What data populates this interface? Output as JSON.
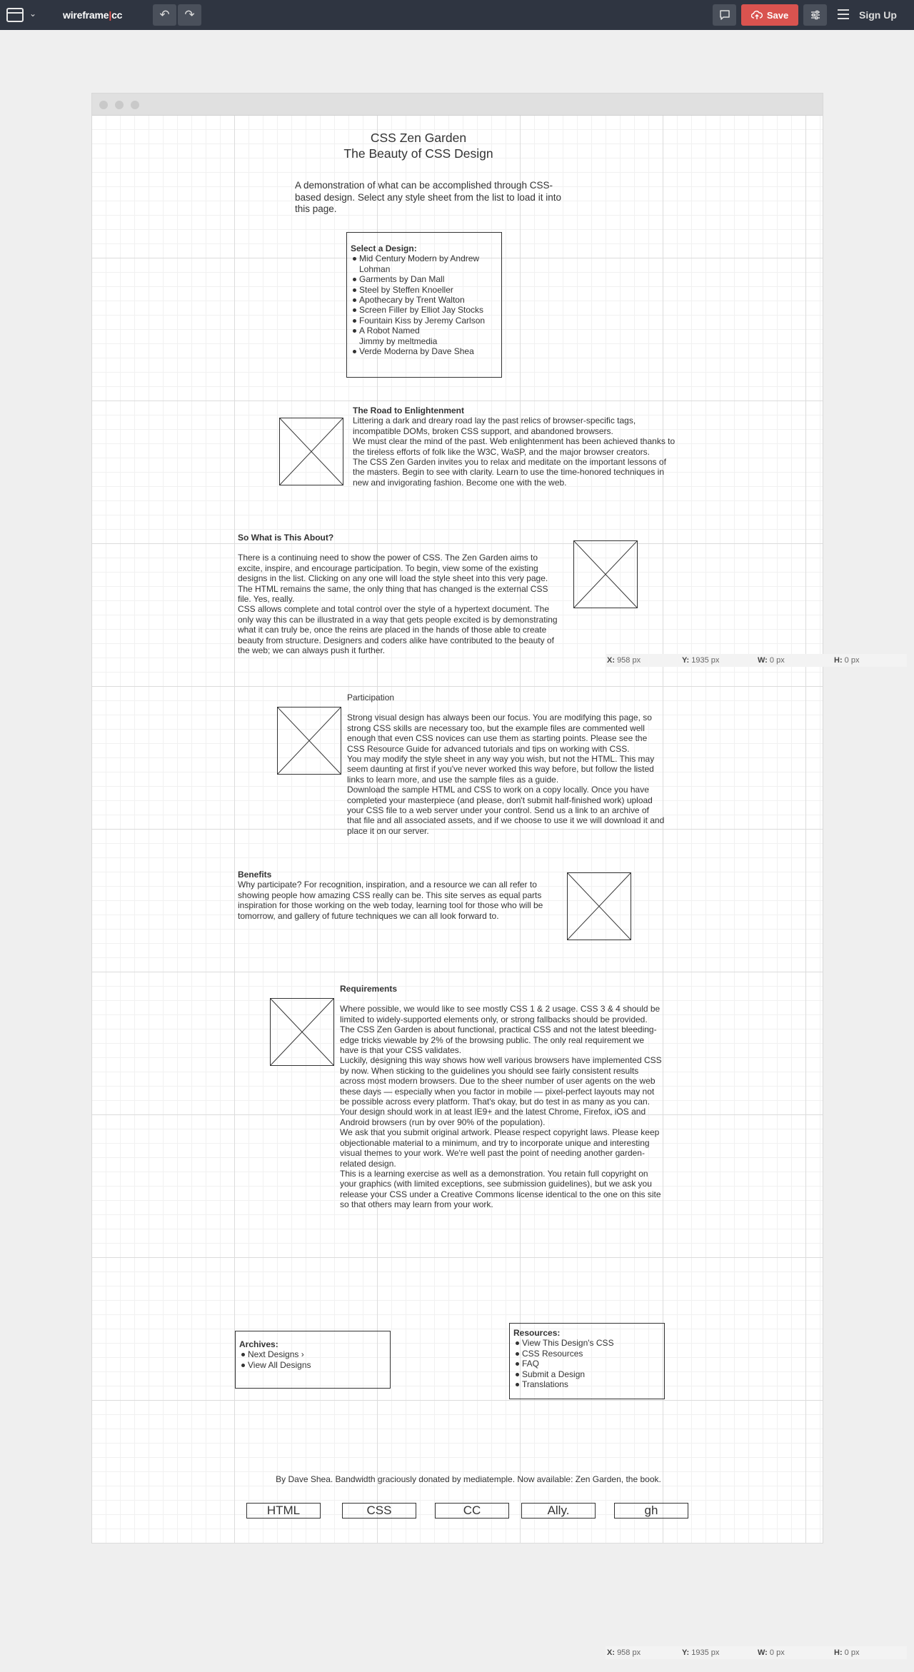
{
  "toolbar": {
    "logo_a": "wireframe",
    "logo_bar": "|",
    "logo_b": "cc",
    "save_label": "Save",
    "signup_label": "Sign Up",
    "icons": {
      "window": "window-icon",
      "chevron": "chevron-down-icon",
      "undo": "undo-icon",
      "redo": "redo-icon",
      "comment": "comment-icon",
      "upload": "cloud-upload-icon",
      "settings": "sliders-icon",
      "menu": "hamburger-icon"
    }
  },
  "page": {
    "title": "CSS Zen Garden",
    "subtitle": "The Beauty of CSS Design",
    "intro": "A demonstration of what can be accomplished through CSS-based design. Select any style sheet from the list to load it into this page.",
    "select_heading": "Select a Design:",
    "designs": [
      "Mid Century Modern by Andrew Lohman",
      "Garments by Dan Mall",
      "Steel by Steffen Knoeller",
      "Apothecary by Trent Walton",
      "Screen Filler by Elliot Jay Stocks",
      "Fountain Kiss by Jeremy Carlson",
      "A Robot Named Jimmy by meltmedia",
      "Verde Moderna by Dave Shea"
    ],
    "road": {
      "heading": "The Road to Enlightenment",
      "p1": "Littering a dark and dreary road lay the past relics of browser-specific tags, incompatible DOMs, broken CSS support, and abandoned browsers.",
      "p2": "We must clear the mind of the past. Web enlightenment has been achieved thanks to the tireless efforts of folk like the W3C, WaSP, and the major browser creators.",
      "p3": "The CSS Zen Garden invites you to relax and meditate on the important lessons of the masters. Begin to see with clarity. Learn to use the time-honored techniques in new and invigorating fashion. Become one with the web."
    },
    "about": {
      "heading": "So What is This About?",
      "p1": "There is a continuing need to show the power of CSS. The Zen Garden aims to excite, inspire, and encourage participation. To begin, view some of the existing designs in the list. Clicking on any one will load the style sheet into this very page. The HTML remains the same, the only thing that has changed is the external CSS file. Yes, really.",
      "p2": "CSS allows complete and total control over the style of a hypertext document. The only way this can be illustrated in a way that gets people excited is by demonstrating what it can truly be, once the reins are placed in the hands of those able to create beauty from structure. Designers and coders alike have contributed to the beauty of the web; we can always push it further."
    },
    "participation": {
      "heading": "Participation",
      "p1": "Strong visual design has always been our focus. You are modifying this page, so strong CSS skills are necessary too, but the example files are commented well enough that even CSS novices can use them as starting points. Please see the CSS Resource Guide for advanced tutorials and tips on working with CSS.",
      "p2": "You may modify the style sheet in any way you wish, but not the HTML. This may seem daunting at first if you've never worked this way before, but follow the listed links to learn more, and use the sample files as a guide.",
      "p3": "Download the sample HTML and CSS to work on a copy locally. Once you have completed your masterpiece (and please, don't submit half-finished work) upload your CSS file to a web server under your control. Send us a link to an archive of that file and all associated assets, and if we choose to use it we will download it and place it on our server."
    },
    "benefits": {
      "heading": "Benefits",
      "p1": "Why participate? For recognition, inspiration, and a resource we can all refer to showing people how amazing CSS really can be. This site serves as equal parts inspiration for those working on the web today, learning tool for those who will be tomorrow, and gallery of future techniques we can all look forward to."
    },
    "requirements": {
      "heading": "Requirements",
      "p1": "Where possible, we would like to see mostly CSS 1 & 2 usage. CSS 3 & 4 should be limited to widely-supported elements only, or strong fallbacks should be provided. The CSS Zen Garden is about functional, practical CSS and not the latest bleeding-edge tricks viewable by 2% of the browsing public. The only real requirement we have is that your CSS validates.",
      "p2": "Luckily, designing this way shows how well various browsers have implemented CSS by now. When sticking to the guidelines you should see fairly consistent results across most modern browsers. Due to the sheer number of user agents on the web these days — especially when you factor in mobile — pixel-perfect layouts may not be possible across every platform. That's okay, but do test in as many as you can. Your design should work in at least IE9+ and the latest Chrome, Firefox, iOS and Android browsers (run by over 90% of the population).",
      "p3": "We ask that you submit original artwork. Please respect copyright laws. Please keep objectionable material to a minimum, and try to incorporate unique and interesting visual themes to your work. We're well past the point of needing another garden-related design.",
      "p4": "This is a learning exercise as well as a demonstration. You retain full copyright on your graphics (with limited exceptions, see submission guidelines), but we ask you release your CSS under a Creative Commons license identical to the one on this site so that others may learn from your work."
    },
    "archives": {
      "heading": "Archives:",
      "items": [
        "Next Designs ›",
        "View All Designs"
      ]
    },
    "resources": {
      "heading": "Resources:",
      "items": [
        "View This Design's CSS",
        "CSS Resources",
        "FAQ",
        "Submit a Design",
        "Translations"
      ]
    },
    "footer": "By Dave Shea. Bandwidth graciously donated by mediatemple. Now available: Zen Garden, the book.",
    "footer_links": [
      "HTML",
      "CSS",
      "CC",
      "Ally.",
      "gh"
    ],
    "image_placeholder_icon": "image-placeholder-icon"
  },
  "coords": {
    "x_label": "X:",
    "x_value": "958 px",
    "y_label": "Y:",
    "y_value": "1935 px",
    "w_label": "W:",
    "w_value": "0 px",
    "h_label": "H:",
    "h_value": "0 px"
  }
}
